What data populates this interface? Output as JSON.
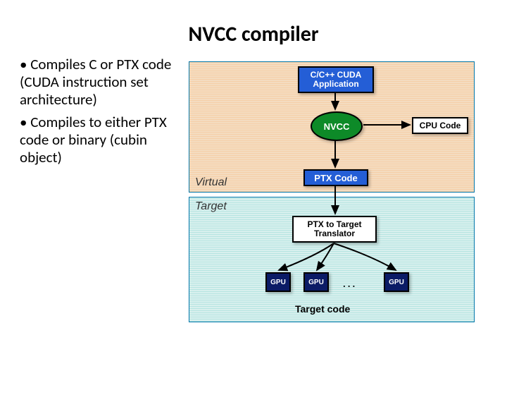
{
  "title": "NVCC compiler",
  "bullets": [
    "Compiles C or PTX code (CUDA instruction set architecture)",
    "Compiles to either PTX code or binary (cubin object)"
  ],
  "diagram": {
    "virtual_label": "Virtual",
    "target_label": "Target",
    "app_line1": "C/C++ CUDA",
    "app_line2": "Application",
    "nvcc": "NVCC",
    "cpu": "CPU Code",
    "ptx": "PTX Code",
    "translator_line1": "PTX to Target",
    "translator_line2": "Translator",
    "gpu": "GPU",
    "dots": "...",
    "target_code": "Target code"
  }
}
